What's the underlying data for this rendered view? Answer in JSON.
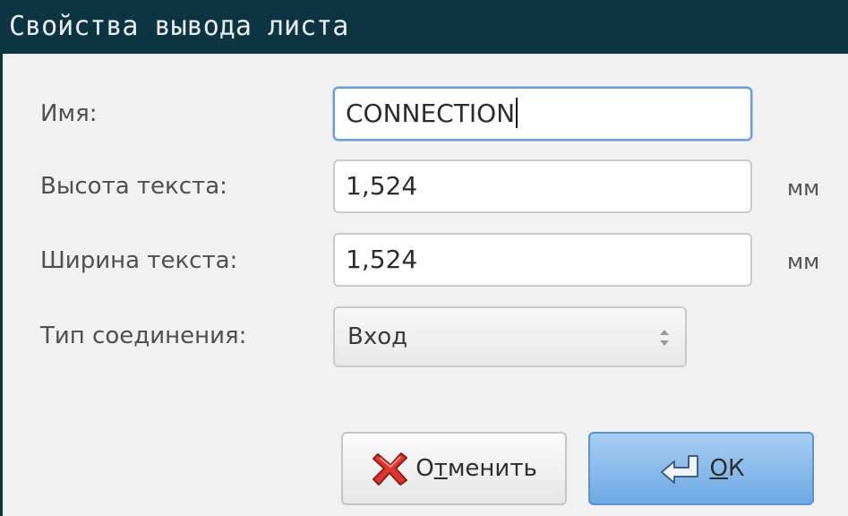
{
  "window": {
    "title": "Свойства вывода листа"
  },
  "form": {
    "name_label": "Имя:",
    "name_value": "CONNECTION",
    "text_height_label": "Высота текста:",
    "text_height_value": "1,524",
    "text_height_unit": "мм",
    "text_width_label": "Ширина текста:",
    "text_width_value": "1,524",
    "text_width_unit": "мм",
    "connection_type_label": "Тип соединения:",
    "connection_type_value": "Вход"
  },
  "buttons": {
    "cancel_mnemonic_pre": "О",
    "cancel_mnemonic_key": "т",
    "cancel_mnemonic_post": "менить",
    "ok_mnemonic_key": "О",
    "ok_mnemonic_post": "К"
  },
  "colors": {
    "titlebar": "#0d3442",
    "ok_button": "#6ea8e4",
    "focus_border": "#6a9fd6"
  },
  "icons": {
    "cancel": "red-x-icon",
    "ok": "return-arrow-icon",
    "spin": "up-down-spinner-icon"
  }
}
